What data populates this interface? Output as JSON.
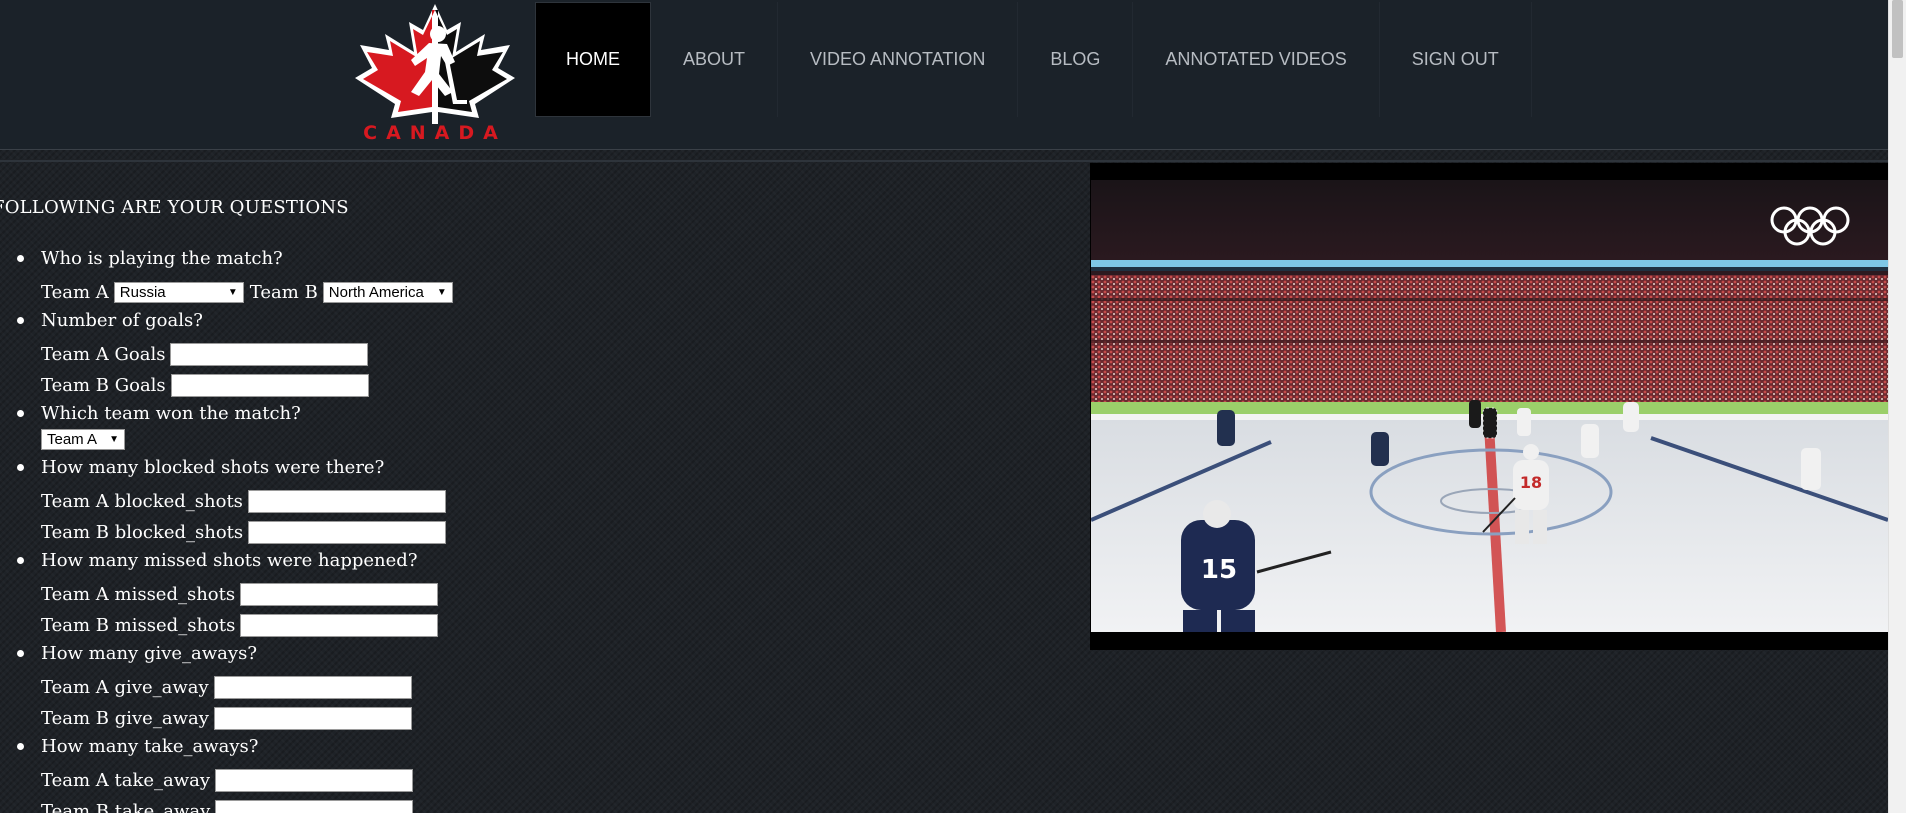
{
  "brand": {
    "wordmark": "CANADA"
  },
  "nav": {
    "items": [
      {
        "label": "HOME",
        "active": true
      },
      {
        "label": "ABOUT"
      },
      {
        "label": "VIDEO ANNOTATION"
      },
      {
        "label": "BLOG"
      },
      {
        "label": "ANNOTATED VIDEOS"
      },
      {
        "label": "SIGN OUT"
      }
    ]
  },
  "questions": {
    "title": "FOLLOWING ARE YOUR QUESTIONS",
    "q1": {
      "text": "Who is playing the match?",
      "team_a_label": "Team A",
      "team_a_value": "Russia",
      "team_b_label": "Team B",
      "team_b_value": "North America"
    },
    "q2": {
      "text": "Number of goals?",
      "a_label": "Team A Goals",
      "b_label": "Team B Goals",
      "a_value": "",
      "b_value": ""
    },
    "q3": {
      "text": "Which team won the match?",
      "winner_value": "Team A"
    },
    "q4": {
      "text": "How many blocked shots were there?",
      "a_label": "Team A blocked_shots",
      "b_label": "Team B blocked_shots",
      "a_value": "",
      "b_value": ""
    },
    "q5": {
      "text": "How many missed shots were happened?",
      "a_label": "Team A missed_shots",
      "b_label": "Team B missed_shots",
      "a_value": "",
      "b_value": ""
    },
    "q6": {
      "text": "How many give_aways?",
      "a_label": "Team A give_away",
      "b_label": "Team B give_away",
      "a_value": "",
      "b_value": ""
    },
    "q7": {
      "text": "How many take_aways?",
      "a_label": "Team A take_away",
      "b_label": "Team B take_away",
      "a_value": "",
      "b_value": ""
    }
  },
  "video": {
    "player_numbers": [
      "15",
      "18"
    ]
  },
  "colors": {
    "header_bg": "#1b2229",
    "accent_red": "#d71920",
    "nav_active_bg": "#000000",
    "nav_text": "#b7bcc2",
    "page_bg": "#1e2227"
  }
}
